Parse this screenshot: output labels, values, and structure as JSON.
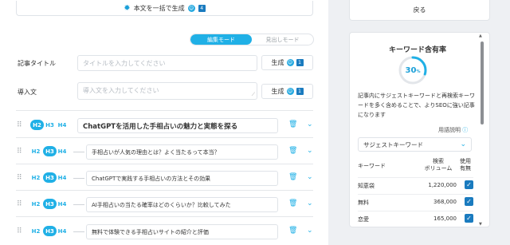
{
  "toolbar": {
    "generate_all_label": "本文を一括で生成",
    "generate_all_count": "4"
  },
  "mode_toggle": {
    "edit": "編集モード",
    "heading": "見出しモード",
    "active": "edit"
  },
  "article": {
    "title_label": "記事タイトル",
    "title_placeholder": "タイトルを入力してください",
    "intro_label": "導入文",
    "intro_placeholder": "導入文を入力してください",
    "generate_label": "生成",
    "generate_count": "1"
  },
  "headings": [
    {
      "level": "H2",
      "labels": [
        "H2",
        "H3",
        "H4"
      ],
      "text": "ChatGPTを活用した手相占いの魅力と実態を探る"
    },
    {
      "level": "H3",
      "labels": [
        "H2",
        "H3",
        "H4"
      ],
      "text": "手相占いが人気の理由とは？よく当たるって本当？"
    },
    {
      "level": "H3",
      "labels": [
        "H2",
        "H3",
        "H4"
      ],
      "text": "ChatGPTで実践する手相占いの方法とその効果"
    },
    {
      "level": "H3",
      "labels": [
        "H2",
        "H3",
        "H4"
      ],
      "text": "AI手相占いの当たる確率はどのくらいか？比較してみた"
    },
    {
      "level": "H3",
      "labels": [
        "H2",
        "H3",
        "H4"
      ],
      "text": "無料で体験できる手相占いサイトの紹介と評価"
    }
  ],
  "sidebar": {
    "back_label": "戻る",
    "keyword_panel": {
      "title": "キーワード含有率",
      "rate": "30",
      "rate_unit": "%",
      "rate_value": 30,
      "description": "記事内にサジェストキーワードと再検索キーワードを多く含めることで、よりSEOに強い記事になります",
      "glossary_label": "用語説明",
      "select_value": "サジェストキーワード",
      "columns": {
        "keyword": "キーワード",
        "volume_1": "検索",
        "volume_2": "ボリューム",
        "use_1": "使用",
        "use_2": "有無"
      },
      "rows": [
        {
          "keyword": "知恵袋",
          "volume": "1,220,000",
          "used": true
        },
        {
          "keyword": "無料",
          "volume": "368,000",
          "used": true
        },
        {
          "keyword": "恋愛",
          "volume": "165,000",
          "used": true
        }
      ]
    }
  },
  "colors": {
    "accent": "#20b0e6",
    "dark_accent": "#1a7bbf",
    "border": "#dfe3e8"
  }
}
